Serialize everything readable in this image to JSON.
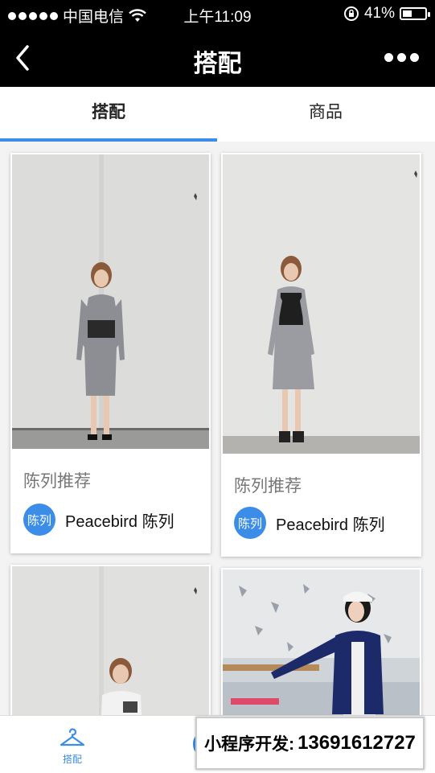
{
  "status_bar": {
    "carrier": "中国电信",
    "time": "上午11:09",
    "battery": "41%",
    "battery_level": 0.41
  },
  "nav": {
    "title": "搭配",
    "back_icon": "chevron-left-icon",
    "more_icon": "more-dots-icon"
  },
  "tabs": [
    {
      "label": "搭配",
      "active": true
    },
    {
      "label": "商品",
      "active": false
    }
  ],
  "cards": [
    {
      "title": "陈列推荐",
      "brand_logo": "陈列",
      "brand": "Peacebird 陈列"
    },
    {
      "title": "陈列推荐",
      "brand_logo": "陈列",
      "brand": "Peacebird 陈列"
    }
  ],
  "bottom_nav": {
    "tab_label": "搭配",
    "tab_icon": "hanger-icon"
  },
  "banner": {
    "label": "小程序开发:",
    "phone": "13691612727"
  },
  "colors": {
    "accent": "#3b8de8",
    "header": "#000000"
  }
}
